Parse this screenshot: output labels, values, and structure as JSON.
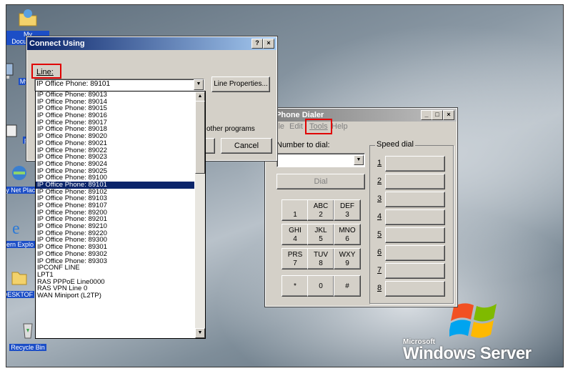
{
  "desktop": {
    "icons": [
      {
        "label": "My Documents",
        "icon": "folder-documents-icon"
      },
      {
        "label": "My C",
        "icon": "computer-icon"
      },
      {
        "label": "put",
        "icon": "shortcut-icon"
      },
      {
        "label": "My Net Plac",
        "icon": "network-places-icon"
      },
      {
        "label": "Intern Explo",
        "icon": "internet-explorer-icon"
      },
      {
        "label": "DESKTOF",
        "icon": "folder-icon"
      },
      {
        "label": "Recycle Bin",
        "icon": "recycle-bin-icon"
      }
    ],
    "brand_small": "Microsoft",
    "brand_big": "Windows Server"
  },
  "connect_dialog": {
    "title": "Connect Using",
    "help_btn": "?",
    "close_btn": "×",
    "line_label": "Line:",
    "line_value": "IP Office Phone: 89101",
    "line_properties_btn": "Line Properties...",
    "other_programs_text": "other programs",
    "cancel_btn": "Cancel",
    "line_options": [
      "IP Office Phone: 89013",
      "IP Office Phone: 89014",
      "IP Office Phone: 89015",
      "IP Office Phone: 89016",
      "IP Office Phone: 89017",
      "IP Office Phone: 89018",
      "IP Office Phone: 89020",
      "IP Office Phone: 89021",
      "IP Office Phone: 89022",
      "IP Office Phone: 89023",
      "IP Office Phone: 89024",
      "IP Office Phone: 89025",
      "IP Office Phone: 89100",
      "IP Office Phone: 89101",
      "IP Office Phone: 89102",
      "IP Office Phone: 89103",
      "IP Office Phone: 89107",
      "IP Office Phone: 89200",
      "IP Office Phone: 89201",
      "IP Office Phone: 89210",
      "IP Office Phone: 89220",
      "IP Office Phone: 89300",
      "IP Office Phone: 89301",
      "IP Office Phone: 89302",
      "IP Office Phone: 89303",
      "IPCONF LINE",
      "LPT1",
      "RAS PPPoE Line0000",
      "RAS VPN Line 0",
      "WAN Miniport (L2TP)"
    ],
    "selected_option": "IP Office Phone: 89101"
  },
  "phone_dialer": {
    "title": "Phone Dialer",
    "menu": [
      "ile",
      "Edit",
      "Tools",
      "Help"
    ],
    "number_label": "Number to dial:",
    "number_value": "",
    "dial_btn": "Dial",
    "speed_dial_label": "Speed dial",
    "speed_dial_numbers": [
      "1",
      "2",
      "3",
      "4",
      "5",
      "6",
      "7",
      "8"
    ],
    "keys": [
      {
        "top": "",
        "bottom": "1"
      },
      {
        "top": "ABC",
        "bottom": "2"
      },
      {
        "top": "DEF",
        "bottom": "3"
      },
      {
        "top": "GHI",
        "bottom": "4"
      },
      {
        "top": "JKL",
        "bottom": "5"
      },
      {
        "top": "MNO",
        "bottom": "6"
      },
      {
        "top": "PRS",
        "bottom": "7"
      },
      {
        "top": "TUV",
        "bottom": "8"
      },
      {
        "top": "WXY",
        "bottom": "9"
      },
      {
        "top": "",
        "bottom": "*"
      },
      {
        "top": "",
        "bottom": "0"
      },
      {
        "top": "",
        "bottom": "#"
      }
    ]
  },
  "highlight_color": "#e00000"
}
